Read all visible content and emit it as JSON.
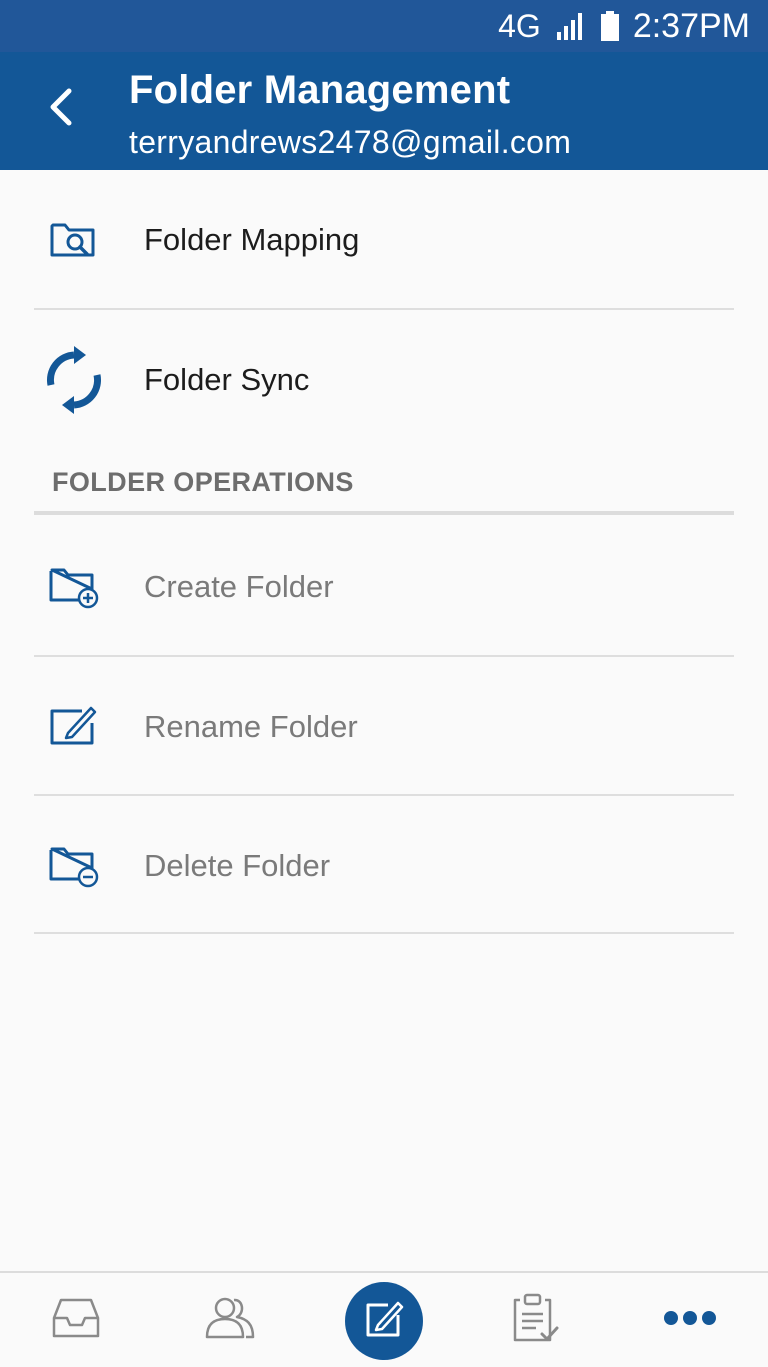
{
  "status_bar": {
    "network": "4G",
    "time": "2:37PM"
  },
  "header": {
    "title": "Folder Management",
    "subtitle": "terryandrews2478@gmail.com",
    "back_icon": "chevron-left-icon"
  },
  "items": [
    {
      "label": "Folder Mapping",
      "icon": "folder-search-icon",
      "enabled": true
    },
    {
      "label": "Folder Sync",
      "icon": "sync-icon",
      "enabled": true
    }
  ],
  "section": {
    "title": "FOLDER OPERATIONS"
  },
  "operations": [
    {
      "label": "Create Folder",
      "icon": "folder-plus-icon",
      "enabled": false
    },
    {
      "label": "Rename Folder",
      "icon": "edit-icon",
      "enabled": false
    },
    {
      "label": "Delete Folder",
      "icon": "folder-minus-icon",
      "enabled": false
    }
  ],
  "bottom_nav": [
    {
      "icon": "inbox-icon"
    },
    {
      "icon": "contacts-icon"
    },
    {
      "icon": "compose-icon"
    },
    {
      "icon": "tasks-icon"
    },
    {
      "icon": "more-icon"
    }
  ],
  "colors": {
    "primary": "#135797",
    "status_bar": "#215799",
    "icon_blue": "#135797",
    "disabled_text": "#7a7a7a"
  }
}
